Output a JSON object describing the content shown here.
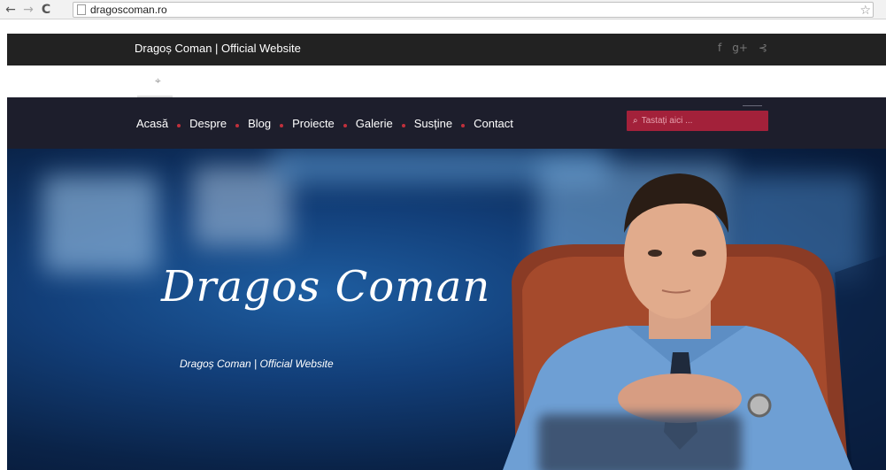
{
  "browser": {
    "back_glyph": "←",
    "forward_glyph": "→",
    "reload_glyph": "C",
    "url": "dragoscoman.ro",
    "star_glyph": "☆"
  },
  "topbar": {
    "tagline": "Dragoș Coman | Official Website",
    "social": [
      {
        "icon": "facebook-icon",
        "glyph": "f"
      },
      {
        "icon": "google-plus-icon",
        "glyph": "g+"
      },
      {
        "icon": "rss-icon",
        "glyph": "⊰"
      }
    ]
  },
  "location_icon_glyph": "⌖",
  "nav": {
    "items": [
      "Acasă",
      "Despre",
      "Blog",
      "Proiecte",
      "Galerie",
      "Susține",
      "Contact"
    ],
    "separator_color": "#c0303c"
  },
  "search": {
    "icon_glyph": "⌕",
    "placeholder": "Tastați aici ...",
    "accent": "#a3213a"
  },
  "hero": {
    "signature": "Dragos Coman",
    "subtitle": "Dragoș Coman | Official Website"
  }
}
